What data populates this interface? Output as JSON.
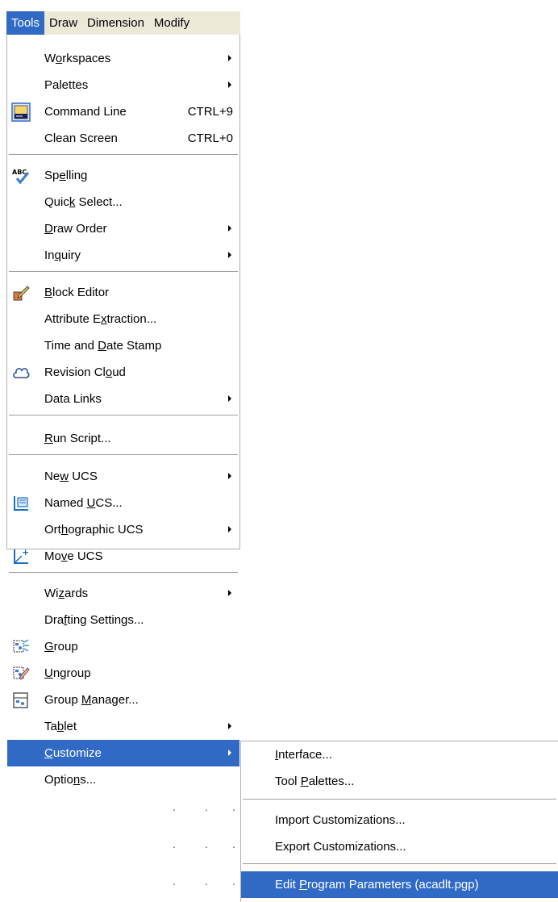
{
  "menubar": {
    "items": [
      {
        "label": "Tools",
        "active": true
      },
      {
        "label": "Draw"
      },
      {
        "label": "Dimension"
      },
      {
        "label": "Modify"
      }
    ]
  },
  "tools_menu": {
    "workspaces": {
      "pre": "W",
      "u": "o",
      "post": "rkspaces"
    },
    "palettes": {
      "pre": "Palettes",
      "u": "",
      "post": ""
    },
    "command_line": {
      "pre": "Command Line",
      "u": "",
      "post": "",
      "shortcut": "CTRL+9"
    },
    "clean_screen": {
      "pre": "Clean Screen",
      "u": "",
      "post": "",
      "shortcut": "CTRL+0"
    },
    "spelling": {
      "pre": "Sp",
      "u": "e",
      "post": "lling"
    },
    "quick_select": {
      "pre": "Quic",
      "u": "k",
      "post": " Select..."
    },
    "draw_order": {
      "pre": "",
      "u": "D",
      "post": "raw Order"
    },
    "inquiry": {
      "pre": "In",
      "u": "q",
      "post": "uiry"
    },
    "block_editor": {
      "pre": "",
      "u": "B",
      "post": "lock Editor"
    },
    "attribute_extraction": {
      "pre": "Attribute E",
      "u": "x",
      "post": "traction..."
    },
    "time_date_stamp": {
      "pre": "Time and ",
      "u": "D",
      "post": "ate Stamp"
    },
    "revision_cloud": {
      "pre": "Revision Cl",
      "u": "o",
      "post": "ud"
    },
    "data_links": {
      "pre": "Data Links",
      "u": "",
      "post": ""
    },
    "run_script": {
      "pre": "",
      "u": "R",
      "post": "un Script..."
    },
    "new_ucs": {
      "pre": "Ne",
      "u": "w",
      "post": " UCS"
    },
    "named_ucs": {
      "pre": "Named ",
      "u": "U",
      "post": "CS..."
    },
    "orthographic_ucs": {
      "pre": "Ort",
      "u": "h",
      "post": "ographic UCS"
    },
    "move_ucs": {
      "pre": "Mo",
      "u": "v",
      "post": "e UCS"
    },
    "wizards": {
      "pre": "Wi",
      "u": "z",
      "post": "ards"
    },
    "drafting_settings": {
      "pre": "Dra",
      "u": "f",
      "post": "ting Settings..."
    },
    "group": {
      "pre": "",
      "u": "G",
      "post": "roup"
    },
    "ungroup": {
      "pre": "",
      "u": "U",
      "post": "ngroup"
    },
    "group_manager": {
      "pre": "Group ",
      "u": "M",
      "post": "anager..."
    },
    "tablet": {
      "pre": "Ta",
      "u": "b",
      "post": "let"
    },
    "customize": {
      "pre": "",
      "u": "C",
      "post": "ustomize"
    },
    "options": {
      "pre": "Optio",
      "u": "n",
      "post": "s..."
    }
  },
  "customize_menu": {
    "interface": {
      "pre": "",
      "u": "I",
      "post": "nterface..."
    },
    "tool_palettes": {
      "pre": "Tool ",
      "u": "P",
      "post": "alettes..."
    },
    "import": {
      "pre": "Import Customizations...",
      "u": "",
      "post": ""
    },
    "export": {
      "pre": "Export Customizations...",
      "u": "",
      "post": ""
    },
    "edit_pgp": {
      "pre": "Edit ",
      "u": "P",
      "post": "rogram Parameters (acadlt.pgp)"
    }
  },
  "colors": {
    "highlight": "#316ac5",
    "menubar": "#ece9d8"
  }
}
